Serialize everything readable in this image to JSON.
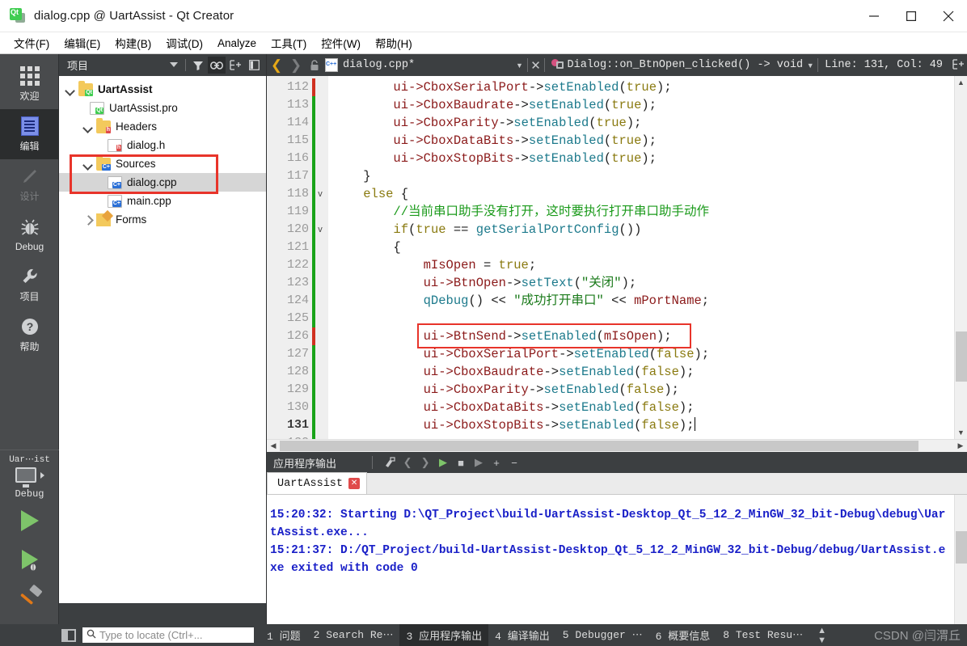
{
  "window": {
    "title": "dialog.cpp @ UartAssist - Qt Creator",
    "app_icon": "qt-logo-icon",
    "minimize_label": "minimize-icon",
    "maximize_label": "maximize-icon",
    "close_label": "close-icon"
  },
  "menubar": {
    "items": [
      {
        "label": "文件(F)",
        "mnemonic": "F"
      },
      {
        "label": "编辑(E)",
        "mnemonic": "E"
      },
      {
        "label": "构建(B)",
        "mnemonic": "B"
      },
      {
        "label": "调试(D)",
        "mnemonic": "D"
      },
      {
        "label": "Analyze",
        "mnemonic": "A"
      },
      {
        "label": "工具(T)",
        "mnemonic": "T"
      },
      {
        "label": "控件(W)",
        "mnemonic": "W"
      },
      {
        "label": "帮助(H)",
        "mnemonic": "H"
      }
    ]
  },
  "modebar": {
    "modes": [
      {
        "label": "欢迎",
        "icon": "grid-icon",
        "state": "normal"
      },
      {
        "label": "编辑",
        "icon": "document-edit-icon",
        "state": "active"
      },
      {
        "label": "设计",
        "icon": "pencil-icon",
        "state": "disabled"
      },
      {
        "label": "Debug",
        "icon": "bug-icon",
        "state": "normal"
      },
      {
        "label": "项目",
        "icon": "wrench-icon",
        "state": "normal"
      },
      {
        "label": "帮助",
        "icon": "question-mark-icon",
        "state": "normal"
      }
    ],
    "kit_selector": {
      "project": "Uar⋯ist",
      "build_config": "Debug",
      "icon": "monitor-icon",
      "arrow": "play-arrow-icon"
    },
    "actions": [
      {
        "name": "run-button",
        "icon": "green-play-icon"
      },
      {
        "name": "start-debugging-button",
        "icon": "green-play-bug-icon"
      },
      {
        "name": "build-button",
        "icon": "hammer-icon"
      }
    ]
  },
  "project_panel": {
    "header": {
      "title": "项目",
      "dropdown_icon": "chevron-down-icon",
      "filter_icon": "filter-icon",
      "link_icon": "link-sync-icon",
      "expand_icon": "expand-all-icon",
      "hide_icon": "hide-sidebar-icon"
    },
    "tree": [
      {
        "label": "UartAssist",
        "indent": 0,
        "twisty": "down",
        "icon": "qt-project-folder-icon",
        "bold": true,
        "selected": false
      },
      {
        "label": "UartAssist.pro",
        "indent": 1,
        "twisty": "none",
        "icon": "qt-pro-file-icon",
        "bold": false,
        "selected": false
      },
      {
        "label": "Headers",
        "indent": 1,
        "twisty": "down",
        "icon": "headers-folder-icon",
        "bold": false,
        "selected": false
      },
      {
        "label": "dialog.h",
        "indent": 2,
        "twisty": "none",
        "icon": "header-file-icon",
        "bold": false,
        "selected": false
      },
      {
        "label": "Sources",
        "indent": 1,
        "twisty": "down",
        "icon": "sources-folder-icon",
        "bold": false,
        "selected": false
      },
      {
        "label": "dialog.cpp",
        "indent": 2,
        "twisty": "none",
        "icon": "cpp-file-icon",
        "bold": false,
        "selected": true
      },
      {
        "label": "main.cpp",
        "indent": 2,
        "twisty": "none",
        "icon": "cpp-file-icon",
        "bold": false,
        "selected": false
      },
      {
        "label": "Forms",
        "indent": 1,
        "twisty": "right",
        "icon": "forms-folder-icon",
        "bold": false,
        "selected": false
      }
    ],
    "highlight_color": "#e8342a"
  },
  "editor_toolbar": {
    "back_icon": "chevron-left-icon",
    "forward_icon": "chevron-right-icon",
    "lock_icon": "unlocked-icon",
    "file_icon": "cpp-file-icon",
    "filename": "dialog.cpp*",
    "file_dropdown_icon": "chevron-down-icon",
    "file_close_icon": "close-icon",
    "symbol_icon": "method-symbol-icon",
    "symbol": "Dialog::on_BtnOpen_clicked() -> void",
    "symbol_dropdown_icon": "chevron-down-icon",
    "line_col": "Line: 131, Col: 49",
    "split_icon": "split-editor-icon"
  },
  "code": {
    "first_line_number": 112,
    "current_line": 131,
    "highlight_box_line": 126,
    "highlight_color": "#e8342a",
    "lines": [
      {
        "n": 112,
        "fold": "",
        "mark": "red",
        "tokens": [
          {
            "t": "        ",
            "c": "plain"
          },
          {
            "t": "ui->CboxSerialPort",
            "c": "obj"
          },
          {
            "t": "->",
            "c": "plain"
          },
          {
            "t": "setEnabled",
            "c": "fn"
          },
          {
            "t": "(",
            "c": "plain"
          },
          {
            "t": "true",
            "c": "kw"
          },
          {
            "t": ");",
            "c": "plain"
          }
        ]
      },
      {
        "n": 113,
        "fold": "",
        "mark": "green",
        "tokens": [
          {
            "t": "        ",
            "c": "plain"
          },
          {
            "t": "ui->CboxBaudrate",
            "c": "obj"
          },
          {
            "t": "->",
            "c": "plain"
          },
          {
            "t": "setEnabled",
            "c": "fn"
          },
          {
            "t": "(",
            "c": "plain"
          },
          {
            "t": "true",
            "c": "kw"
          },
          {
            "t": ");",
            "c": "plain"
          }
        ]
      },
      {
        "n": 114,
        "fold": "",
        "mark": "green",
        "tokens": [
          {
            "t": "        ",
            "c": "plain"
          },
          {
            "t": "ui->CboxParity",
            "c": "obj"
          },
          {
            "t": "->",
            "c": "plain"
          },
          {
            "t": "setEnabled",
            "c": "fn"
          },
          {
            "t": "(",
            "c": "plain"
          },
          {
            "t": "true",
            "c": "kw"
          },
          {
            "t": ");",
            "c": "plain"
          }
        ]
      },
      {
        "n": 115,
        "fold": "",
        "mark": "green",
        "tokens": [
          {
            "t": "        ",
            "c": "plain"
          },
          {
            "t": "ui->CboxDataBits",
            "c": "obj"
          },
          {
            "t": "->",
            "c": "plain"
          },
          {
            "t": "setEnabled",
            "c": "fn"
          },
          {
            "t": "(",
            "c": "plain"
          },
          {
            "t": "true",
            "c": "kw"
          },
          {
            "t": ");",
            "c": "plain"
          }
        ]
      },
      {
        "n": 116,
        "fold": "",
        "mark": "green",
        "tokens": [
          {
            "t": "        ",
            "c": "plain"
          },
          {
            "t": "ui->CboxStopBits",
            "c": "obj"
          },
          {
            "t": "->",
            "c": "plain"
          },
          {
            "t": "setEnabled",
            "c": "fn"
          },
          {
            "t": "(",
            "c": "plain"
          },
          {
            "t": "true",
            "c": "kw"
          },
          {
            "t": ");",
            "c": "plain"
          }
        ]
      },
      {
        "n": 117,
        "fold": "",
        "mark": "green",
        "tokens": [
          {
            "t": "    }",
            "c": "plain"
          }
        ]
      },
      {
        "n": 118,
        "fold": "v",
        "mark": "green",
        "tokens": [
          {
            "t": "    ",
            "c": "plain"
          },
          {
            "t": "else",
            "c": "kw"
          },
          {
            "t": " {",
            "c": "plain"
          }
        ]
      },
      {
        "n": 119,
        "fold": "",
        "mark": "green",
        "tokens": [
          {
            "t": "        ",
            "c": "plain"
          },
          {
            "t": "//当前串口助手没有打开，这时要执行打开串口助手动作",
            "c": "cmt"
          }
        ]
      },
      {
        "n": 120,
        "fold": "v",
        "mark": "green",
        "tokens": [
          {
            "t": "        ",
            "c": "plain"
          },
          {
            "t": "if",
            "c": "kw"
          },
          {
            "t": "(",
            "c": "plain"
          },
          {
            "t": "true",
            "c": "kw"
          },
          {
            "t": " == ",
            "c": "plain"
          },
          {
            "t": "getSerialPortConfig",
            "c": "fn"
          },
          {
            "t": "())",
            "c": "plain"
          }
        ]
      },
      {
        "n": 121,
        "fold": "",
        "mark": "green",
        "tokens": [
          {
            "t": "        {",
            "c": "plain"
          }
        ]
      },
      {
        "n": 122,
        "fold": "",
        "mark": "green",
        "tokens": [
          {
            "t": "            ",
            "c": "plain"
          },
          {
            "t": "mIsOpen",
            "c": "obj"
          },
          {
            "t": " = ",
            "c": "plain"
          },
          {
            "t": "true",
            "c": "kw"
          },
          {
            "t": ";",
            "c": "plain"
          }
        ]
      },
      {
        "n": 123,
        "fold": "",
        "mark": "green",
        "tokens": [
          {
            "t": "            ",
            "c": "plain"
          },
          {
            "t": "ui->BtnOpen",
            "c": "obj"
          },
          {
            "t": "->",
            "c": "plain"
          },
          {
            "t": "setText",
            "c": "fn"
          },
          {
            "t": "(",
            "c": "plain"
          },
          {
            "t": "\"关闭\"",
            "c": "str"
          },
          {
            "t": ");",
            "c": "plain"
          }
        ]
      },
      {
        "n": 124,
        "fold": "",
        "mark": "green",
        "tokens": [
          {
            "t": "            ",
            "c": "plain"
          },
          {
            "t": "qDebug",
            "c": "fn"
          },
          {
            "t": "() << ",
            "c": "plain"
          },
          {
            "t": "\"成功打开串口\"",
            "c": "str"
          },
          {
            "t": " << ",
            "c": "plain"
          },
          {
            "t": "mPortName",
            "c": "obj"
          },
          {
            "t": ";",
            "c": "plain"
          }
        ]
      },
      {
        "n": 125,
        "fold": "",
        "mark": "green",
        "tokens": [
          {
            "t": "",
            "c": "plain"
          }
        ]
      },
      {
        "n": 126,
        "fold": "",
        "mark": "red",
        "tokens": [
          {
            "t": "            ",
            "c": "plain"
          },
          {
            "t": "ui->BtnSend",
            "c": "obj"
          },
          {
            "t": "->",
            "c": "plain"
          },
          {
            "t": "setEnabled",
            "c": "fn"
          },
          {
            "t": "(",
            "c": "plain"
          },
          {
            "t": "mIsOpen",
            "c": "obj"
          },
          {
            "t": ");",
            "c": "plain"
          }
        ]
      },
      {
        "n": 127,
        "fold": "",
        "mark": "green",
        "tokens": [
          {
            "t": "            ",
            "c": "plain"
          },
          {
            "t": "ui->CboxSerialPort",
            "c": "obj"
          },
          {
            "t": "->",
            "c": "plain"
          },
          {
            "t": "setEnabled",
            "c": "fn"
          },
          {
            "t": "(",
            "c": "plain"
          },
          {
            "t": "false",
            "c": "kw"
          },
          {
            "t": ");",
            "c": "plain"
          }
        ]
      },
      {
        "n": 128,
        "fold": "",
        "mark": "green",
        "tokens": [
          {
            "t": "            ",
            "c": "plain"
          },
          {
            "t": "ui->CboxBaudrate",
            "c": "obj"
          },
          {
            "t": "->",
            "c": "plain"
          },
          {
            "t": "setEnabled",
            "c": "fn"
          },
          {
            "t": "(",
            "c": "plain"
          },
          {
            "t": "false",
            "c": "kw"
          },
          {
            "t": ");",
            "c": "plain"
          }
        ]
      },
      {
        "n": 129,
        "fold": "",
        "mark": "green",
        "tokens": [
          {
            "t": "            ",
            "c": "plain"
          },
          {
            "t": "ui->CboxParity",
            "c": "obj"
          },
          {
            "t": "->",
            "c": "plain"
          },
          {
            "t": "setEnabled",
            "c": "fn"
          },
          {
            "t": "(",
            "c": "plain"
          },
          {
            "t": "false",
            "c": "kw"
          },
          {
            "t": ");",
            "c": "plain"
          }
        ]
      },
      {
        "n": 130,
        "fold": "",
        "mark": "green",
        "tokens": [
          {
            "t": "            ",
            "c": "plain"
          },
          {
            "t": "ui->CboxDataBits",
            "c": "obj"
          },
          {
            "t": "->",
            "c": "plain"
          },
          {
            "t": "setEnabled",
            "c": "fn"
          },
          {
            "t": "(",
            "c": "plain"
          },
          {
            "t": "false",
            "c": "kw"
          },
          {
            "t": ");",
            "c": "plain"
          }
        ]
      },
      {
        "n": 131,
        "fold": "",
        "mark": "green",
        "tokens": [
          {
            "t": "            ",
            "c": "plain"
          },
          {
            "t": "ui->CboxStopBits",
            "c": "obj"
          },
          {
            "t": "->",
            "c": "plain"
          },
          {
            "t": "setEnabled",
            "c": "fn"
          },
          {
            "t": "(",
            "c": "plain"
          },
          {
            "t": "false",
            "c": "kw"
          },
          {
            "t": ");",
            "c": "plain"
          }
        ],
        "caret": true
      },
      {
        "n": 132,
        "fold": "",
        "mark": "green",
        "tokens": [
          {
            "t": "",
            "c": "plain"
          }
        ]
      }
    ]
  },
  "output_pane": {
    "title": "应用程序输出",
    "toolbar": [
      {
        "name": "clear-output-button",
        "icon": "broom-icon"
      },
      {
        "name": "prev-item-button",
        "icon": "chevron-left-icon"
      },
      {
        "name": "next-item-button",
        "icon": "chevron-right-icon"
      },
      {
        "name": "run-button",
        "icon": "green-play-icon"
      },
      {
        "name": "stop-button",
        "icon": "stop-square-icon"
      },
      {
        "name": "attach-debugger-button",
        "icon": "play-bug-icon"
      },
      {
        "name": "zoom-in-button",
        "icon": "plus-icon"
      },
      {
        "name": "zoom-out-button",
        "icon": "minus-icon"
      }
    ],
    "tabs": [
      {
        "label": "UartAssist",
        "close_icon": "close-tab-icon",
        "active": true
      }
    ],
    "lines": [
      "15:20:32: Starting D:\\QT_Project\\build-UartAssist-Desktop_Qt_5_12_2_MinGW_32_bit-Debug\\debug\\UartAssist.exe...",
      "15:21:37: D:/QT_Project/build-UartAssist-Desktop_Qt_5_12_2_MinGW_32_bit-Debug/debug/UartAssist.exe exited with code 0"
    ],
    "text_color": "#1a20c8"
  },
  "statusbar": {
    "sidebar_toggle_icon": "toggle-sidebar-icon",
    "search": {
      "icon": "search-icon",
      "placeholder": "Type to locate (Ctrl+..."
    },
    "panes": [
      {
        "num": "1",
        "label": "问题",
        "active": false
      },
      {
        "num": "2",
        "label": "Search Re⋯",
        "active": false
      },
      {
        "num": "3",
        "label": "应用程序输出",
        "active": true
      },
      {
        "num": "4",
        "label": "编译输出",
        "active": false
      },
      {
        "num": "5",
        "label": "Debugger ⋯",
        "active": false
      },
      {
        "num": "6",
        "label": "概要信息",
        "active": false
      },
      {
        "num": "8",
        "label": "Test Resu⋯",
        "active": false
      }
    ],
    "updown_icon": "up-down-arrows-icon",
    "watermark": "CSDN @闫渭丘"
  }
}
